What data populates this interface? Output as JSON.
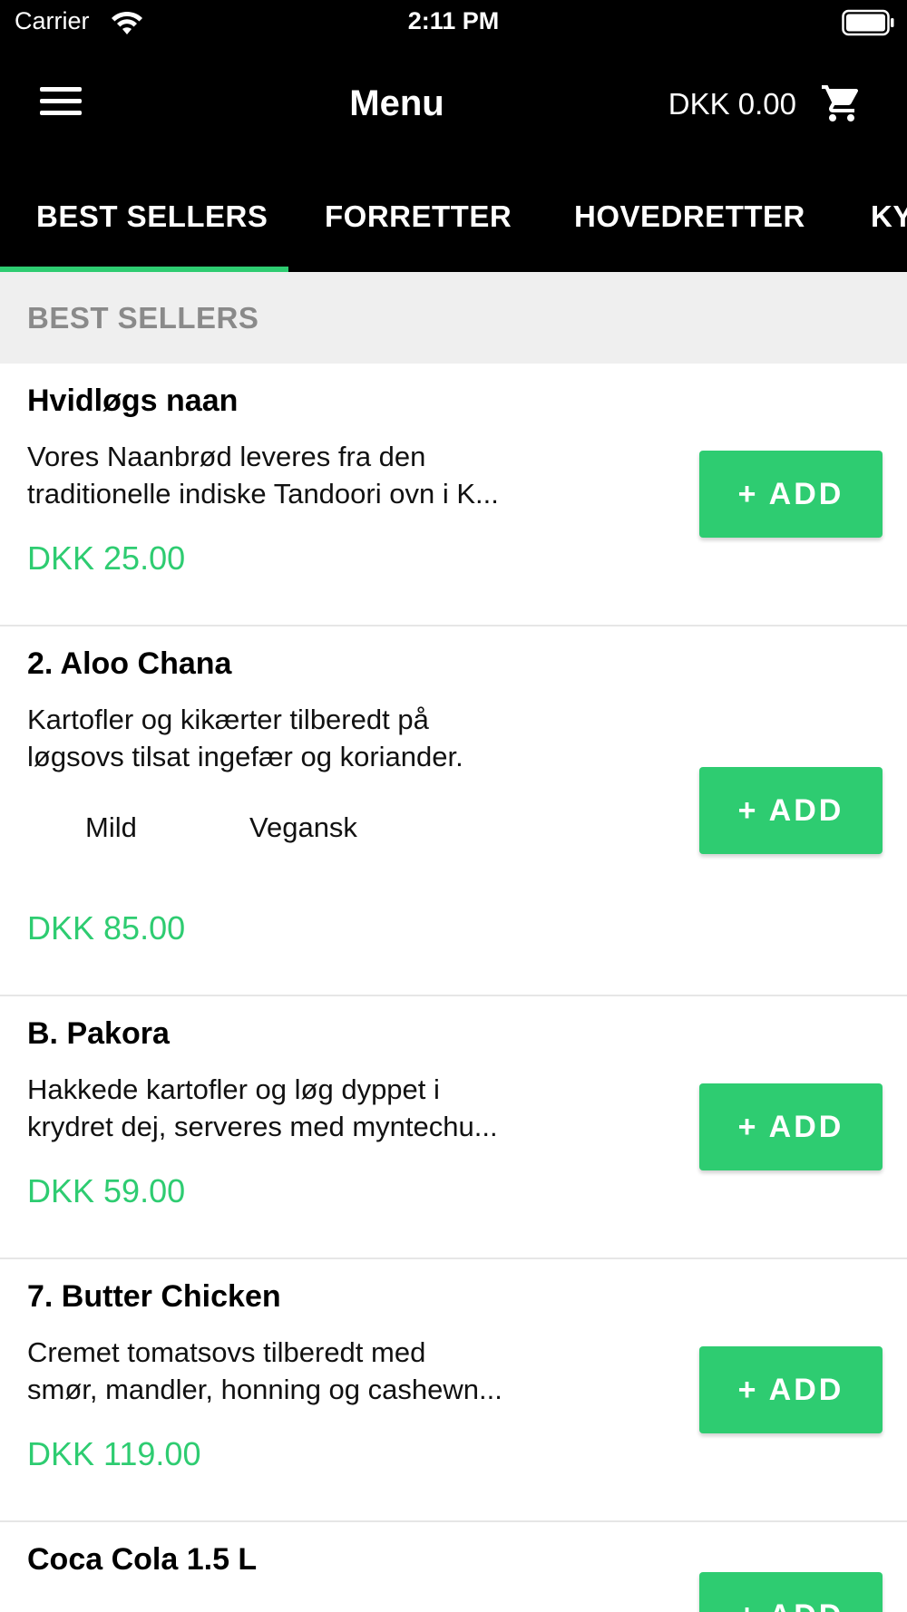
{
  "status_bar": {
    "carrier": "Carrier",
    "time": "2:11 PM",
    "wifi_icon": "wifi-icon",
    "battery_icon": "battery-icon"
  },
  "nav": {
    "menu_icon": "hamburger-menu-icon",
    "title": "Menu",
    "cart_total": "DKK 0.00",
    "cart_icon": "shopping-cart-icon"
  },
  "tabs": [
    {
      "label": "BEST SELLERS",
      "active": true
    },
    {
      "label": "FORRETTER",
      "active": false
    },
    {
      "label": "HOVEDRETTER",
      "active": false
    },
    {
      "label": "KY",
      "active": false
    }
  ],
  "section": {
    "title": "BEST SELLERS"
  },
  "colors": {
    "accent": "#2ecc71",
    "header_bg": "#000000",
    "section_bg": "#efefef"
  },
  "items": [
    {
      "name": "Hvidløgs naan",
      "desc": "Vores Naanbrød leveres fra den\ntraditionelle indiske Tandoori ovn i K...",
      "price": "DKK 25.00",
      "add_label": "+ ADD"
    },
    {
      "name": "2. Aloo Chana",
      "desc": "Kartofler og kikærter tilberedt på\nløgsovs tilsat ingefær og koriander.",
      "tags": [
        "Mild",
        "Vegansk"
      ],
      "price": "DKK 85.00",
      "add_label": "+ ADD"
    },
    {
      "name": "B. Pakora",
      "desc": "Hakkede kartofler og løg dyppet i\nkrydret dej, serveres med myntechu...",
      "price": "DKK 59.00",
      "add_label": "+ ADD"
    },
    {
      "name": "7. Butter Chicken",
      "desc": "Cremet tomatsovs tilberedt med\nsmør, mandler, honning og cashewn...",
      "price": "DKK 119.00",
      "add_label": "+ ADD"
    },
    {
      "name": "Coca Cola 1.5 L",
      "add_label": "+ ADD"
    }
  ]
}
